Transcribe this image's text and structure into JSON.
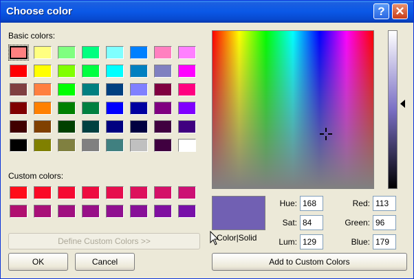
{
  "window": {
    "title": "Choose color"
  },
  "titlebar": {
    "help_glyph": "?",
    "close_glyph": "✕"
  },
  "basic": {
    "label": "Basic colors:",
    "colors": [
      [
        "#ff8080",
        "#ffff80",
        "#80ff80",
        "#00ff80",
        "#80ffff",
        "#0080ff",
        "#ff80c0",
        "#ff80ff"
      ],
      [
        "#ff0000",
        "#ffff00",
        "#80ff00",
        "#00ff40",
        "#00ffff",
        "#0080c0",
        "#8080c0",
        "#ff00ff"
      ],
      [
        "#804040",
        "#ff8040",
        "#00ff00",
        "#008080",
        "#004080",
        "#8080ff",
        "#800040",
        "#ff0080"
      ],
      [
        "#800000",
        "#ff8000",
        "#008000",
        "#008040",
        "#0000ff",
        "#0000a0",
        "#800080",
        "#8000ff"
      ],
      [
        "#400000",
        "#804000",
        "#004000",
        "#004040",
        "#000080",
        "#000040",
        "#400040",
        "#400080"
      ],
      [
        "#000000",
        "#808000",
        "#808040",
        "#808080",
        "#408080",
        "#c0c0c0",
        "#400040",
        "#ffffff"
      ]
    ]
  },
  "custom": {
    "label": "Custom colors:",
    "colors": [
      [
        "#ff0d1a",
        "#fa0a26",
        "#f50a32",
        "#ee0c40",
        "#e60e4d",
        "#dd105c",
        "#d41068",
        "#cc1074"
      ],
      [
        "#b01070",
        "#a81078",
        "#a01080",
        "#981088",
        "#901090",
        "#881098",
        "#8010a0",
        "#7810a8"
      ]
    ]
  },
  "buttons": {
    "define_custom": "Define Custom Colors >>",
    "ok": "OK",
    "cancel": "Cancel",
    "add_custom": "Add to Custom Colors"
  },
  "preview": {
    "label": "Color|Solid",
    "color": "#7160b3"
  },
  "fields": {
    "hue_label": "Hue:",
    "hue": "168",
    "sat_label": "Sat:",
    "sat": "84",
    "lum_label": "Lum:",
    "lum": "129",
    "red_label": "Red:",
    "red": "113",
    "green_label": "Green:",
    "green": "96",
    "blue_label": "Blue:",
    "blue": "179"
  }
}
